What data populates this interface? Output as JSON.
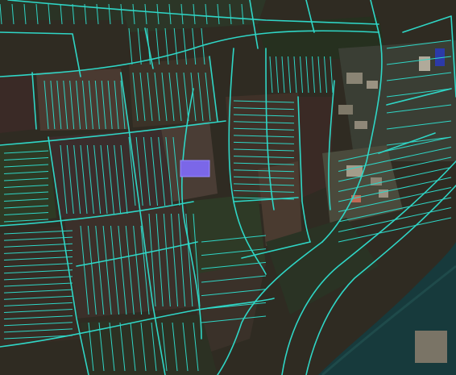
{
  "map": {
    "layer": "satellite",
    "parcel_outline_color": "#2fd6c6",
    "selected_parcel_color": "#7b67e8",
    "river_color": "#173a3c",
    "field_colors": [
      "#3a2f2a",
      "#4a3a31",
      "#2e3a24",
      "#5a4a3c",
      "#3b3328",
      "#26301f"
    ]
  }
}
